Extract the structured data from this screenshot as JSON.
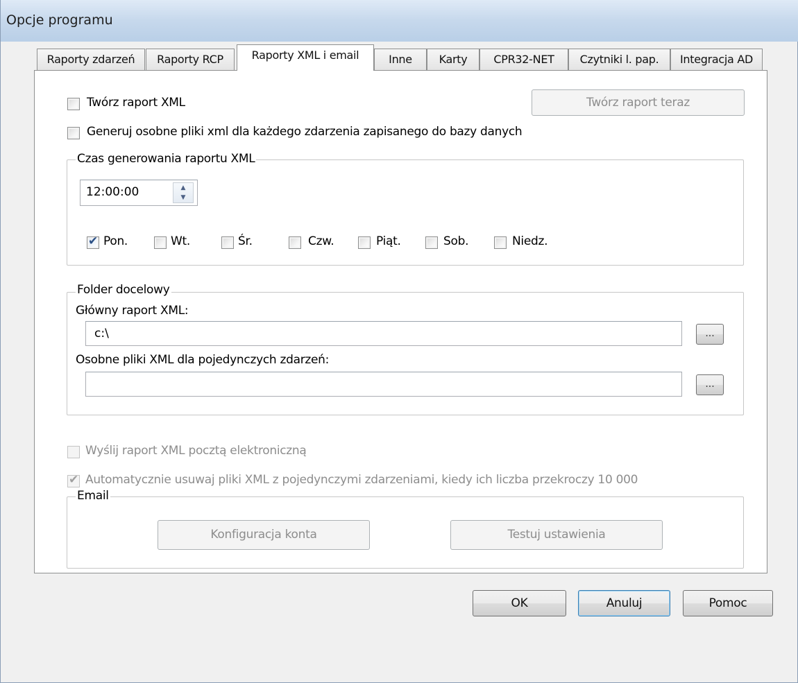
{
  "window": {
    "title": "Opcje programu"
  },
  "tabs": [
    {
      "label": "Raporty zdarzeń"
    },
    {
      "label": "Raporty RCP"
    },
    {
      "label": "Raporty XML i email"
    },
    {
      "label": "Inne"
    },
    {
      "label": "Karty"
    },
    {
      "label": "CPR32-NET"
    },
    {
      "label": "Czytniki l. pap."
    },
    {
      "label": "Integracja AD"
    }
  ],
  "active_tab": "Raporty XML i email",
  "xml": {
    "create_report_label": "Twórz raport XML",
    "create_report_checked": false,
    "create_now_label": "Twórz raport teraz",
    "separate_files_label": "Generuj osobne pliki xml dla każdego zdarzenia zapisanego do bazy danych",
    "separate_files_checked": false
  },
  "schedule": {
    "legend": "Czas generowania raportu XML",
    "time": "12:00:00",
    "days": [
      {
        "label": "Pon.",
        "checked": true
      },
      {
        "label": "Wt.",
        "checked": false
      },
      {
        "label": "Śr.",
        "checked": false
      },
      {
        "label": "Czw.",
        "checked": false
      },
      {
        "label": "Piąt.",
        "checked": false
      },
      {
        "label": "Sob.",
        "checked": false
      },
      {
        "label": "Niedz.",
        "checked": false
      }
    ]
  },
  "folder": {
    "legend": "Folder docelowy",
    "main_label": "Główny raport XML:",
    "main_value": "c:\\",
    "browse_label": "...",
    "single_label": "Osobne pliki XML dla pojedynczych zdarzeń:",
    "single_value": ""
  },
  "email_opts": {
    "send_label": "Wyślij raport XML pocztą elektroniczną",
    "send_checked": false,
    "auto_delete_label": "Automatycznie usuwaj pliki XML z pojedynczymi zdarzeniami, kiedy ich liczba przekroczy 10 000",
    "auto_delete_checked": true
  },
  "email": {
    "legend": "Email",
    "account_config_label": "Konfiguracja konta",
    "test_settings_label": "Testuj ustawienia"
  },
  "footer": {
    "ok_label": "OK",
    "cancel_label": "Anuluj",
    "help_label": "Pomoc"
  },
  "colors": {
    "titlebar": "#c6d8ec",
    "window_bg": "#f0f0f0",
    "disabled_text": "#8d8d8d",
    "check_mark": "#2a4f85"
  }
}
